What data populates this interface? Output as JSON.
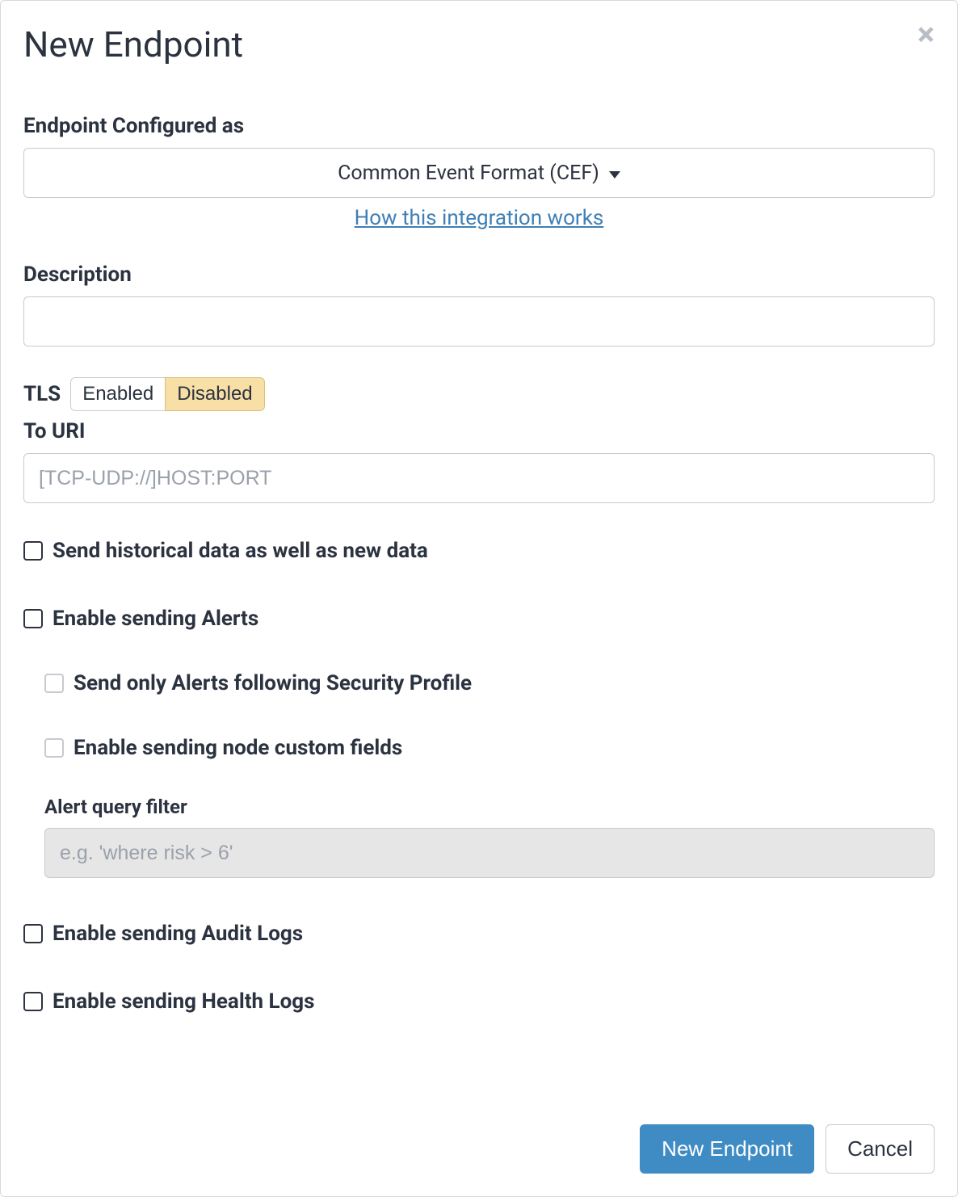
{
  "modal": {
    "title": "New Endpoint",
    "close_icon": "×"
  },
  "fields": {
    "endpoint_configured_as": {
      "label": "Endpoint Configured as",
      "value": "Common Event Format (CEF)"
    },
    "help_link": "How this integration works",
    "description": {
      "label": "Description",
      "value": ""
    },
    "tls": {
      "label": "TLS",
      "options": {
        "enabled": "Enabled",
        "disabled": "Disabled"
      },
      "selected": "disabled"
    },
    "to_uri": {
      "label": "To URI",
      "value": "",
      "placeholder": "[TCP-UDP://]HOST:PORT"
    },
    "send_historical": {
      "label": "Send historical data as well as new data",
      "checked": false
    },
    "enable_alerts": {
      "label": "Enable sending Alerts",
      "checked": false
    },
    "send_only_security_profile": {
      "label": "Send only Alerts following Security Profile",
      "checked": false
    },
    "enable_node_custom_fields": {
      "label": "Enable sending node custom fields",
      "checked": false
    },
    "alert_query_filter": {
      "label": "Alert query filter",
      "value": "",
      "placeholder": "e.g. 'where risk > 6'"
    },
    "enable_audit_logs": {
      "label": "Enable sending Audit Logs",
      "checked": false
    },
    "enable_health_logs": {
      "label": "Enable sending Health Logs",
      "checked": false
    }
  },
  "footer": {
    "primary": "New Endpoint",
    "secondary": "Cancel"
  }
}
